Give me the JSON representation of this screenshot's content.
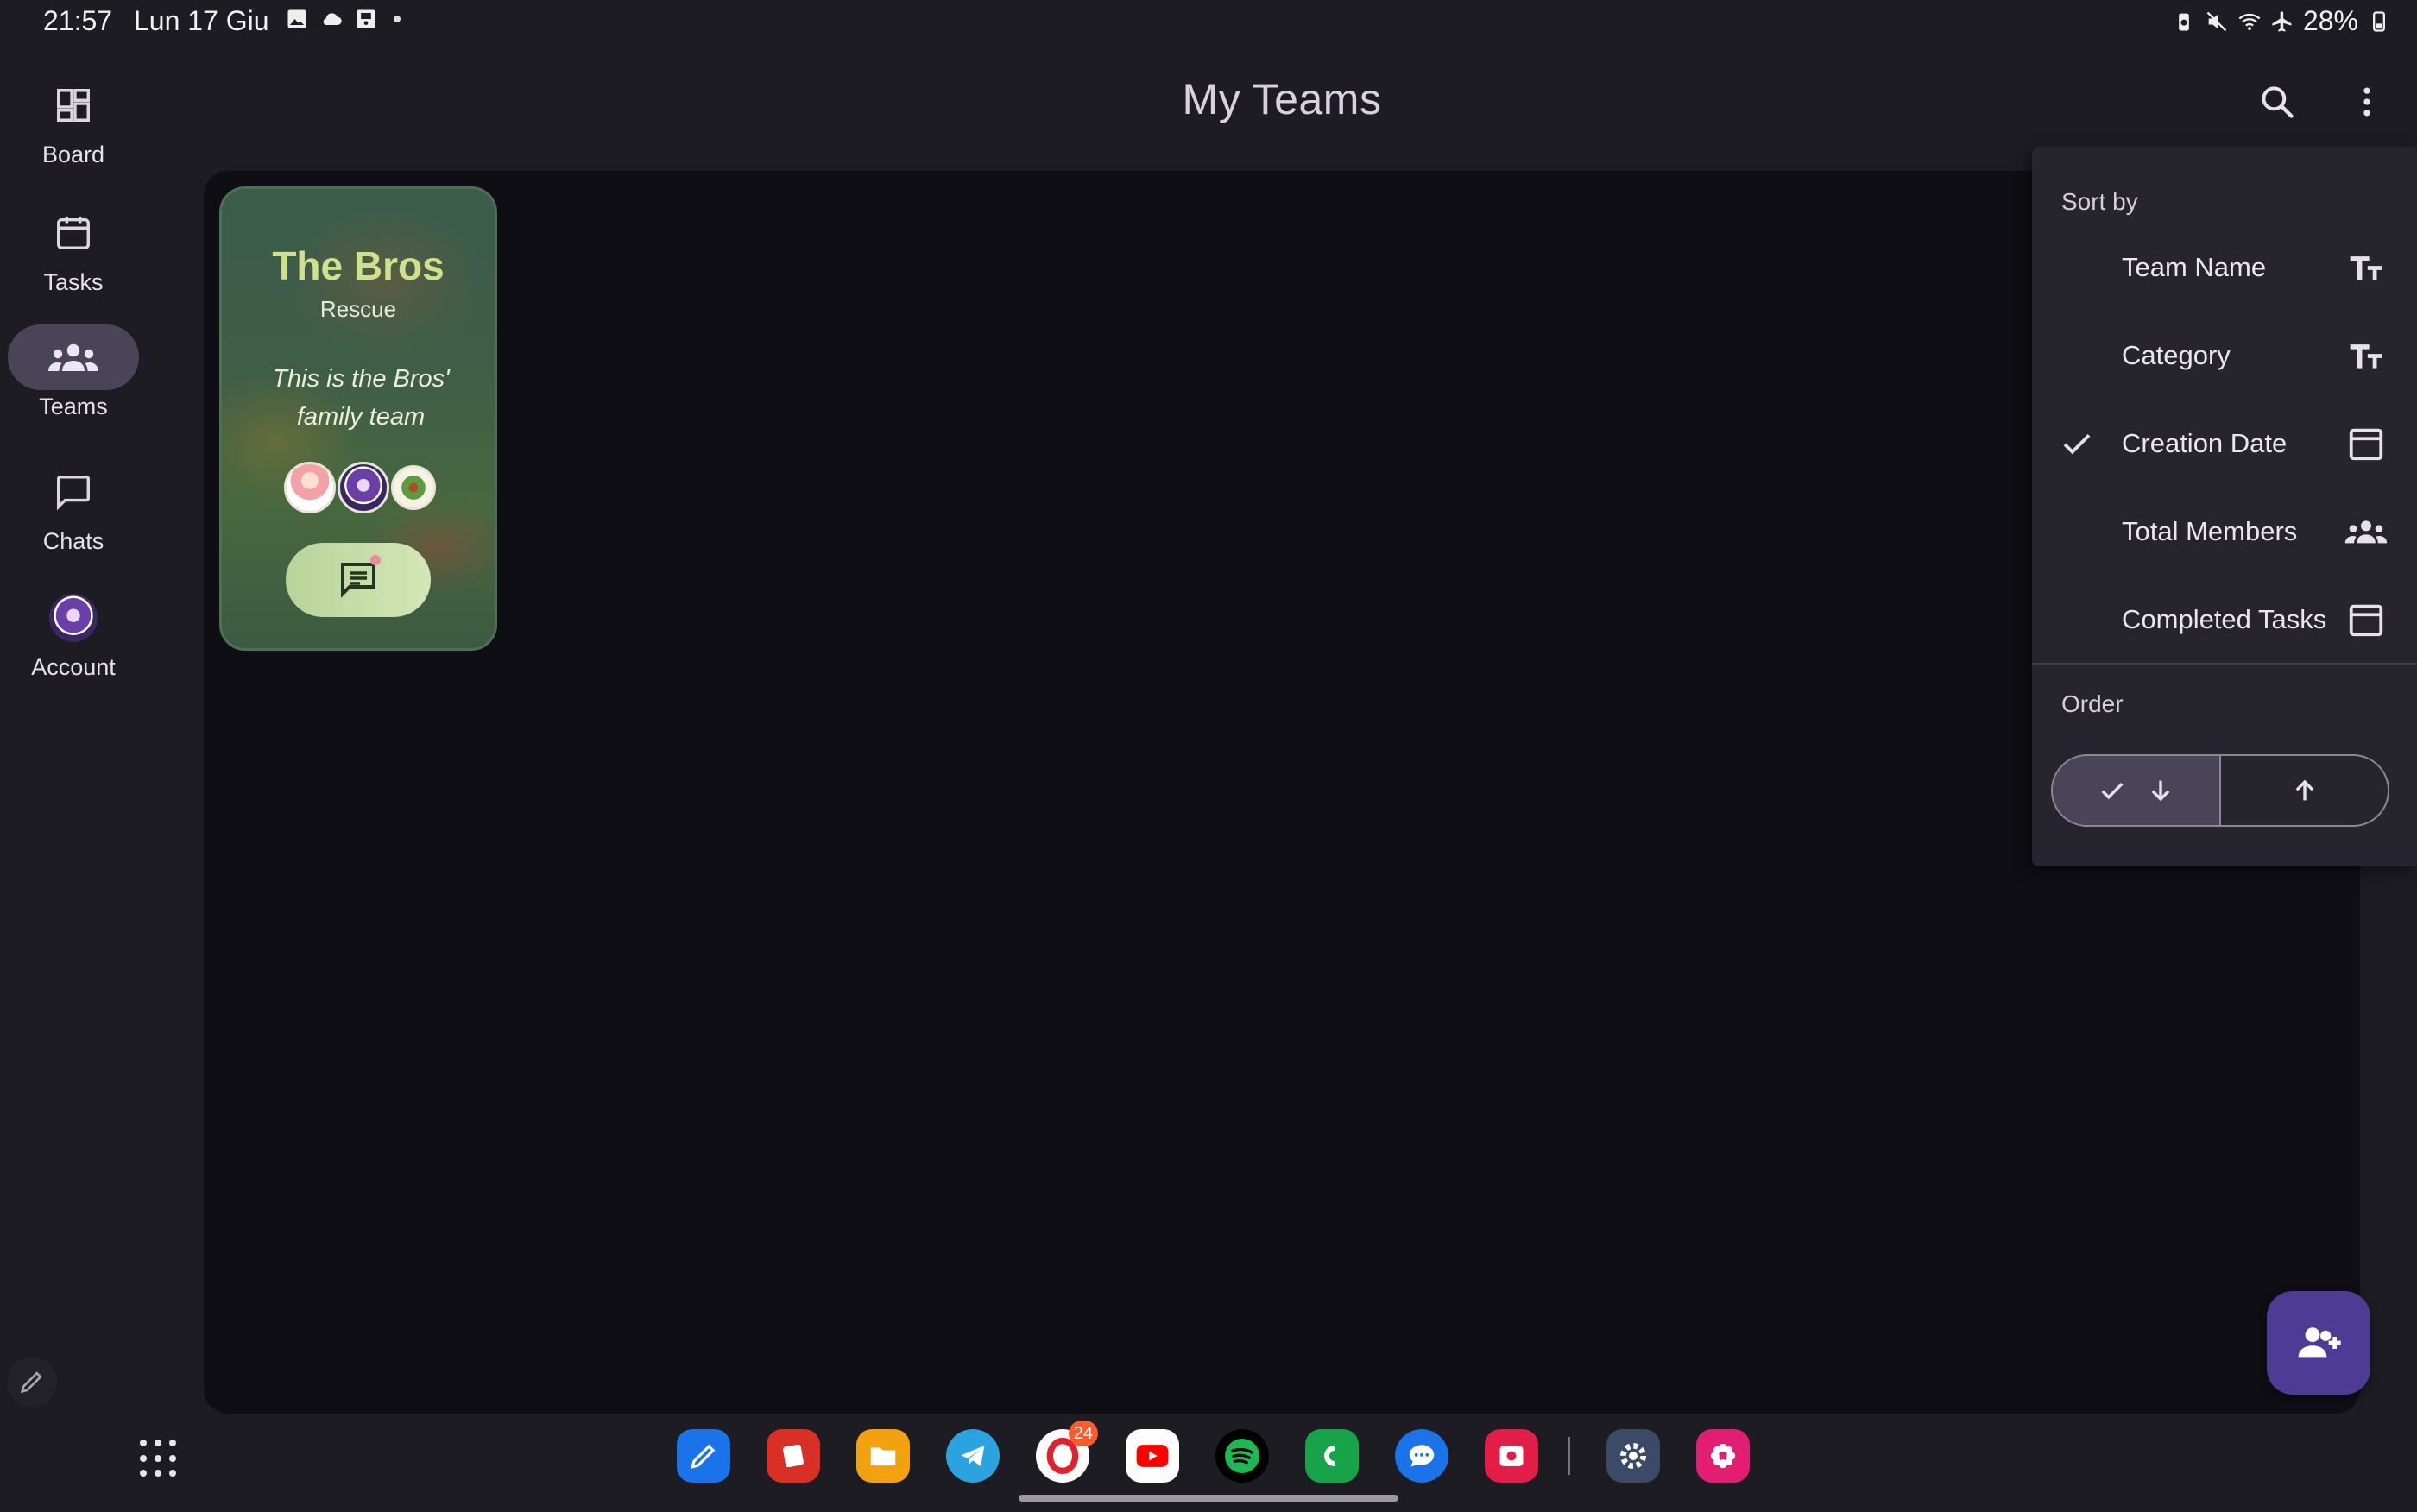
{
  "status_bar": {
    "time": "21:57",
    "date": "Lun 17 Giu",
    "left_icons": [
      "gallery-icon",
      "cloud-icon",
      "storage-icon",
      "dot-icon"
    ],
    "right_icons": [
      "battery-saver-icon",
      "mute-icon",
      "wifi-icon",
      "airplane-icon"
    ],
    "battery": "28%"
  },
  "nav_rail": {
    "items": [
      {
        "label": "Board",
        "icon": "dashboard-icon"
      },
      {
        "label": "Tasks",
        "icon": "calendar-icon"
      },
      {
        "label": "Teams",
        "icon": "groups-icon",
        "active": true
      },
      {
        "label": "Chats",
        "icon": "chat-bubble-icon"
      },
      {
        "label": "Account",
        "icon": "avatar-icon"
      }
    ]
  },
  "top_bar": {
    "title": "My Teams"
  },
  "team_card": {
    "name": "The Bros",
    "category": "Rescue",
    "description": "This is the Bros' family team",
    "members": [
      "member-1",
      "member-2",
      "member-3"
    ]
  },
  "sort_menu": {
    "sort_by_label": "Sort by",
    "options": [
      {
        "label": "Team Name",
        "icon": "text-format-icon",
        "checked": false
      },
      {
        "label": "Category",
        "icon": "text-format-icon",
        "checked": false
      },
      {
        "label": "Creation Date",
        "icon": "calendar-icon",
        "checked": true
      },
      {
        "label": "Total Members",
        "icon": "groups-icon",
        "checked": false
      },
      {
        "label": "Completed Tasks",
        "icon": "calendar-icon",
        "checked": false
      }
    ],
    "order_label": "Order",
    "order_selected": "descending"
  },
  "dock": {
    "apps": [
      {
        "name": "notes",
        "color": "#1a73e8"
      },
      {
        "name": "flashcards",
        "color": "#d93025"
      },
      {
        "name": "files",
        "color": "#f2a20f"
      },
      {
        "name": "telegram",
        "color": "#2aa3df"
      },
      {
        "name": "opera",
        "color": "#ffffff",
        "badge": "24"
      },
      {
        "name": "youtube",
        "color": "#ffffff"
      },
      {
        "name": "spotify",
        "color": "#1db954"
      },
      {
        "name": "phone",
        "color": "#16a34a"
      },
      {
        "name": "messages",
        "color": "#1a73e8"
      },
      {
        "name": "screen-recorder",
        "color": "#e11d48"
      },
      {
        "name": "settings",
        "color": "#3b4a66"
      },
      {
        "name": "bixby-flower",
        "color": "#e11d74"
      }
    ]
  },
  "colors": {
    "background": "#1d1c22",
    "content": "#0f0e14",
    "accent": "#4e3b95",
    "rail_active": "#4a4458",
    "card_title": "#cfe08f"
  }
}
